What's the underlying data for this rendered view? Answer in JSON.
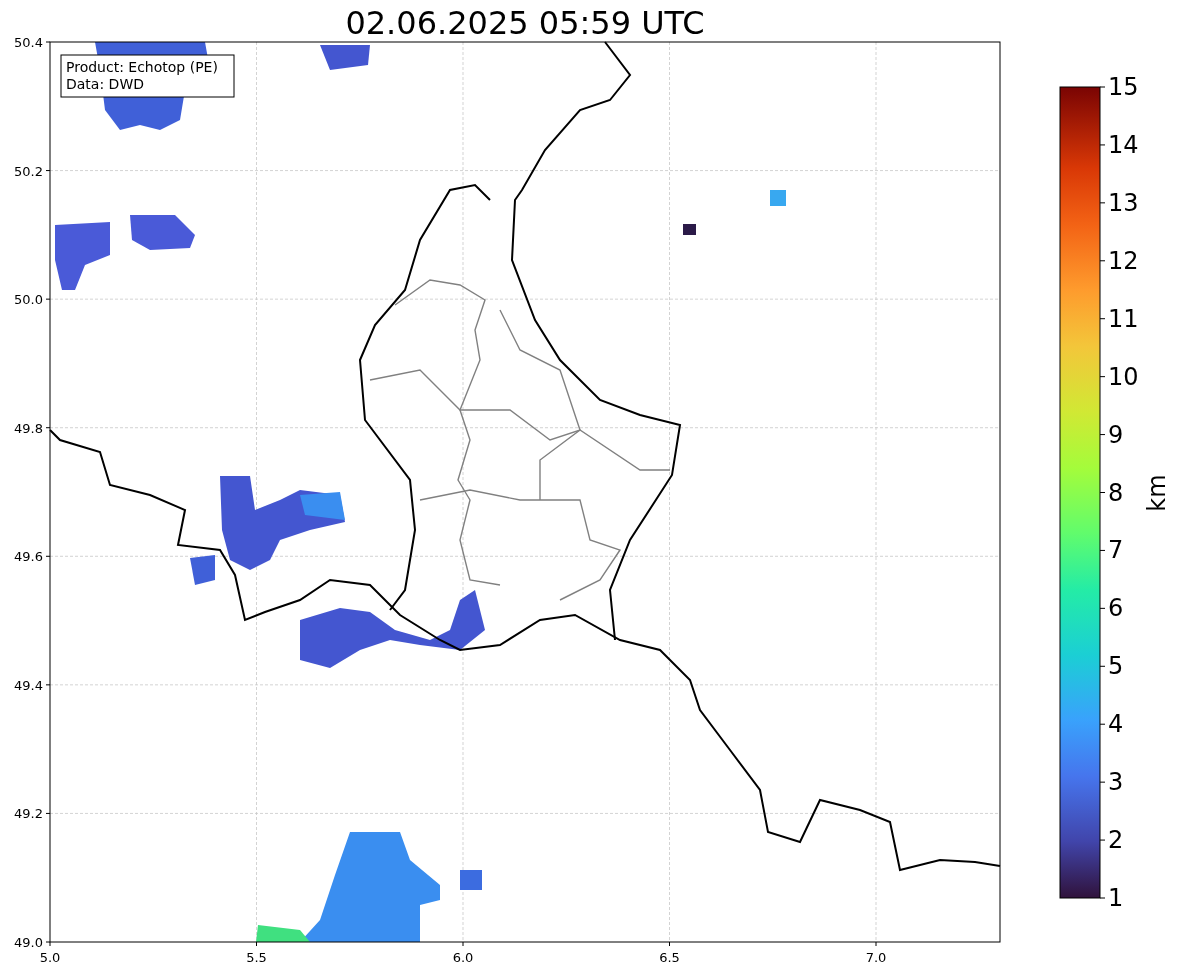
{
  "title": "02.06.2025 05:59 UTC",
  "legend": {
    "lines": [
      "Product: Echotop (PE)",
      "Data: DWD"
    ]
  },
  "map": {
    "x_ticks": [
      "5.0",
      "5.5",
      "6.0",
      "6.5",
      "7.0"
    ],
    "y_ticks": [
      "50.4",
      "50.2",
      "50.0",
      "49.8",
      "49.6",
      "49.4",
      "49.2",
      "49.0"
    ]
  },
  "colorbar": {
    "label": "km",
    "ticks": [
      "15",
      "14",
      "13",
      "12",
      "11",
      "10",
      "9",
      "8",
      "7",
      "6",
      "5",
      "4",
      "3",
      "2",
      "1"
    ]
  }
}
